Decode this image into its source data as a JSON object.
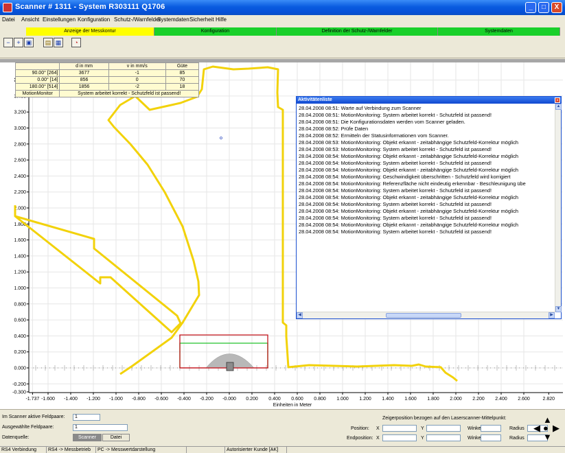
{
  "window": {
    "title": "Scanner  # 1311 - System  R303111  Q1706",
    "btn_min": "_",
    "btn_max": "□",
    "btn_close": "X"
  },
  "menu": [
    "Datei",
    "Ansicht",
    "Einstellungen",
    "Konfiguration",
    "Schutz-/Warnfelder",
    "Systemdaten",
    "Sicherheit",
    "Hilfe"
  ],
  "tabs": [
    {
      "label": "Anzeige der Messkontur",
      "color": "#ffff00"
    },
    {
      "label": "Konfiguration",
      "color": "#19d02a"
    },
    {
      "label": "Definition der Schutz-/Warnfelder",
      "color": "#19d02a"
    },
    {
      "label": "Systemdaten",
      "color": "#19d02a"
    }
  ],
  "toolbar_icons": [
    "zoom-out-icon",
    "zoom-in-icon",
    "zoom-fit-icon",
    "lock-icon",
    "save-icon",
    "speedometer-icon"
  ],
  "info_table": {
    "headers": [
      "d in mm",
      "v in mm/s",
      "Güte"
    ],
    "rows": [
      {
        "label": "90.00°  [264]",
        "d": "3677",
        "v": "-1",
        "guete": "85"
      },
      {
        "label": "0.00°  [14]",
        "d": "856",
        "v": "0",
        "guete": "70"
      },
      {
        "label": "180.00°  [514]",
        "d": "1856",
        "v": "-2",
        "guete": "18"
      }
    ],
    "motion_label": "MotionMonitor",
    "motion_text": "System arbeitet korrekt - Schutzfeld ist passend!"
  },
  "activity": {
    "title": "Aktivitätenliste",
    "entries": [
      "28.04.2008 08:51: Warte auf Verbindung zum Scanner",
      "28.04.2008 08:51: MotionMonitoring: System arbeitet korrekt - Schutzfeld ist passend!",
      "28.04.2008 08:51: Die Konfigurationsdaten werden vom Scanner geladen.",
      "28.04.2008 08:52: Prüfe Daten",
      "28.04.2008 08:52: Ermitteln der Statusinformationen vom Scanner.",
      "28.04.2008 08:53: MotionMonitoring: Objekt erkannt - zeitabhängige Schutzfeld-Korrektur möglich",
      "28.04.2008 08:53: MotionMonitoring: System arbeitet korrekt - Schutzfeld ist passend!",
      "28.04.2008 08:54: MotionMonitoring: Objekt erkannt - zeitabhängige Schutzfeld-Korrektur möglich",
      "28.04.2008 08:54: MotionMonitoring: System arbeitet korrekt - Schutzfeld ist passend!",
      "28.04.2008 08:54: MotionMonitoring: Objekt erkannt - zeitabhängige Schutzfeld-Korrektur möglich",
      "28.04.2008 08:54: MotionMonitoring: Geschwindigkeit überschritten - Schutzfeld wird korrigiert",
      "28.04.2008 08:54: MotionMonitoring: Referenzfläche nicht eindeutig erkennbar - Beschleunigung übe",
      "28.04.2008 08:54: MotionMonitoring: System arbeitet korrekt - Schutzfeld ist passend!",
      "28.04.2008 08:54: MotionMonitoring: Objekt erkannt - zeitabhängige Schutzfeld-Korrektur möglich",
      "28.04.2008 08:54: MotionMonitoring: System arbeitet korrekt - Schutzfeld ist passend!",
      "28.04.2008 08:54: MotionMonitoring: Objekt erkannt - zeitabhängige Schutzfeld-Korrektur möglich",
      "28.04.2008 08:54: MotionMonitoring: System arbeitet korrekt - Schutzfeld ist passend!",
      "28.04.2008 08:54: MotionMonitoring: Objekt erkannt - zeitabhängige Schutzfeld-Korrektur möglich",
      "28.04.2008 08:54: MotionMonitoring: System arbeitet korrekt - Schutzfeld ist passend!"
    ]
  },
  "plot": {
    "y_ticks": [
      "3.607",
      "3.600",
      "3.400",
      "3.200",
      "3.000",
      "2.800",
      "2.600",
      "2.400",
      "2.200",
      "2.000",
      "1.800",
      "1.600",
      "1.400",
      "1.200",
      "1.000",
      "0.800",
      "0.600",
      "0.400",
      "0.200",
      "0.000",
      "-0.200",
      "-0.300"
    ],
    "x_ticks": [
      "-1.737",
      "-1.600",
      "-1.400",
      "-1.200",
      "-1.000",
      "-0.800",
      "-0.600",
      "-0.400",
      "-0.200",
      "-0.000",
      "0.200",
      "0.400",
      "0.600",
      "0.800",
      "1.000",
      "1.200",
      "1.400",
      "1.600",
      "1.800",
      "2.000",
      "2.200",
      "2.400",
      "2.600",
      "2.820"
    ],
    "x_label": "Einheiten in Meter",
    "contour_color": "#f2d20a",
    "warn_field_color": "#22c22a",
    "protect_field_color": "#c4141c"
  },
  "bottom": {
    "active_pairs_label": "Im Scanner aktive Feldpaare:",
    "active_pairs_value": "1",
    "selected_pair_label": "Ausgewählte Feldpaare:",
    "selected_pair_value": "1",
    "source_label": "Datenquelle:",
    "source_scanner": "Scanner",
    "source_file": "Datei",
    "pointer_caption": "Zeigerposition bezogen auf den Laserscanner-Mittelpunkt:",
    "position_label": "Position:",
    "endposition_label": "Endposition:",
    "x_label": "X",
    "y_label": "Y",
    "angle_label": "Winkel",
    "radius_label": "Radius"
  },
  "statusbar": [
    "RS4 Verbindung",
    "RS4 -> Messbetrieb",
    "PC -> Messwertdarstellung",
    "",
    "Autorisierter Kunde [AK]"
  ]
}
